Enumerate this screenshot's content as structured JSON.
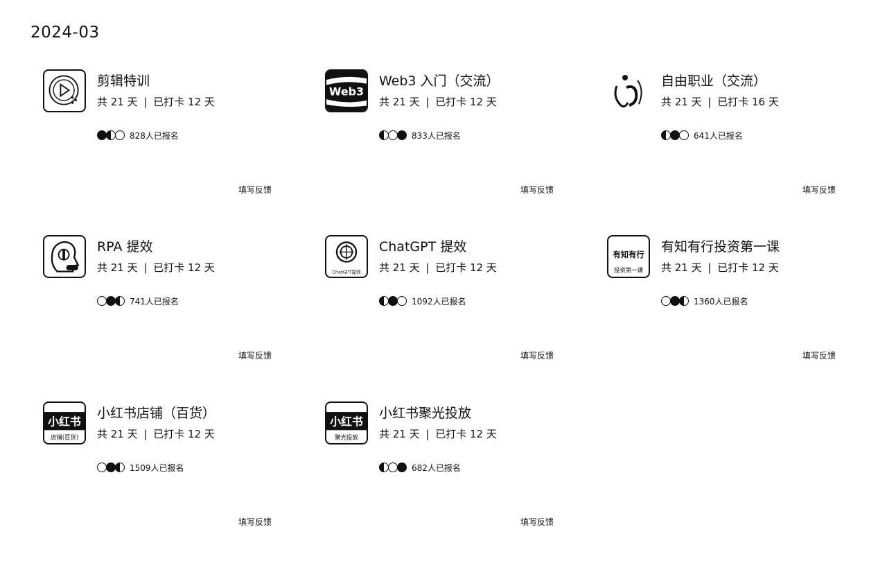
{
  "month": "2024-03",
  "cards": [
    {
      "title": "剪辑特训",
      "total": "共 21 天",
      "sep": "|",
      "checkin": "已打卡 12 天",
      "enrolled": "828人已报名",
      "feedback": "填写反馈"
    },
    {
      "title": "Web3 入门（交流）",
      "total": "共 21 天",
      "sep": "|",
      "checkin": "已打卡 12 天",
      "enrolled": "833人已报名",
      "feedback": "填写反馈",
      "thumb_text": "Web3"
    },
    {
      "title": "自由职业（交流）",
      "total": "共 21 天",
      "sep": "|",
      "checkin": "已打卡 16 天",
      "enrolled": "641人已报名",
      "feedback": "填写反馈"
    },
    {
      "title": "RPA 提效",
      "total": "共 21 天",
      "sep": "|",
      "checkin": "已打卡 12 天",
      "enrolled": "741人已报名",
      "feedback": "填写反馈"
    },
    {
      "title": "ChatGPT 提效",
      "total": "共 21 天",
      "sep": "|",
      "checkin": "已打卡 12 天",
      "enrolled": "1092人已报名",
      "feedback": "填写反馈",
      "thumb_text": "ChatGPT提效"
    },
    {
      "title": "有知有行投资第一课",
      "total": "共 21 天",
      "sep": "|",
      "checkin": "已打卡 12 天",
      "enrolled": "1360人已报名",
      "feedback": "填写反馈",
      "thumb_text": "有知有行",
      "thumb_sub": "投资第一课"
    },
    {
      "title": "小红书店铺（百货）",
      "total": "共 21 天",
      "sep": "|",
      "checkin": "已打卡 12 天",
      "enrolled": "1509人已报名",
      "feedback": "填写反馈",
      "thumb_text": "小红书",
      "thumb_sub": "店铺(百货)"
    },
    {
      "title": "小红书聚光投放",
      "total": "共 21 天",
      "sep": "|",
      "checkin": "已打卡 12 天",
      "enrolled": "682人已报名",
      "feedback": "填写反馈",
      "thumb_text": "小红书",
      "thumb_sub": "聚光投放"
    }
  ]
}
